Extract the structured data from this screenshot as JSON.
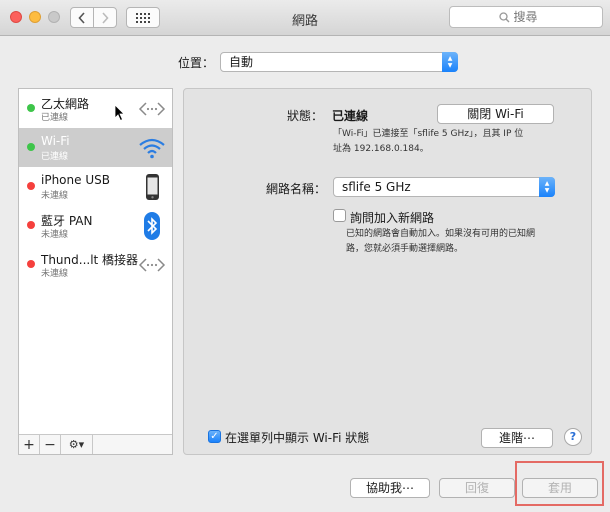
{
  "window": {
    "title": "網路"
  },
  "toolbar": {
    "search_placeholder": "搜尋"
  },
  "location": {
    "label": "位置：",
    "value": "自動"
  },
  "services": [
    {
      "name": "乙太網路",
      "status": "已連線",
      "dot": "green",
      "icon": "ethernet-icon"
    },
    {
      "name": "Wi-Fi",
      "status": "已連線",
      "dot": "green",
      "icon": "wifi-icon",
      "selected": true
    },
    {
      "name": "iPhone USB",
      "status": "未連線",
      "dot": "red",
      "icon": "iphone-icon"
    },
    {
      "name": "藍牙 PAN",
      "status": "未連線",
      "dot": "red",
      "icon": "bluetooth-icon"
    },
    {
      "name": "Thund...lt 橋接器",
      "status": "未連線",
      "dot": "red",
      "icon": "thunderbolt-bridge-icon"
    }
  ],
  "sidebar_tools": {
    "add": "+",
    "remove": "−",
    "gear": "⚙▾"
  },
  "detail": {
    "status_label": "狀態：",
    "status_value": "已連線",
    "toggle_wifi_button": "關閉 Wi-Fi",
    "status_desc_line1": "「Wi-Fi」已連接至「sflife 5 GHz」，且其 IP 位",
    "status_desc_line2": "址為 192.168.0.184。",
    "network_name_label": "網路名稱：",
    "network_name_value": "sflife 5 GHz",
    "ask_join_label": "詢問加入新網路",
    "ask_join_desc_line1": "已知的網路會自動加入。如果沒有可用的已知網",
    "ask_join_desc_line2": "路，您就必須手動選擇網路。",
    "show_status_label": "在選單列中顯示 Wi-Fi 狀態",
    "advanced_button": "進階⋯",
    "help_button": "?"
  },
  "footer": {
    "assist_button": "協助我⋯",
    "revert_button": "回復",
    "apply_button": "套用"
  },
  "colors": {
    "accent": "#1a82fb",
    "connected": "#3ec54a",
    "disconnected": "#f5403d",
    "highlight": "#e46a64"
  }
}
